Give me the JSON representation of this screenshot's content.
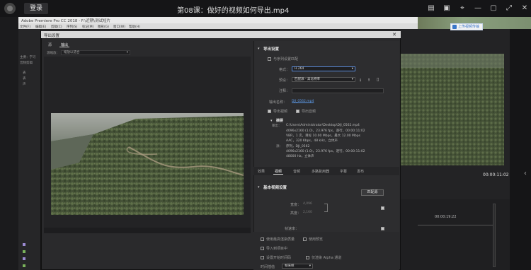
{
  "player": {
    "login_label": "登录",
    "video_title": "第08课：做好的视频如何导出.mp4",
    "tag_text": "上传视频传输"
  },
  "premiere": {
    "title": "Adobe Premiere Pro CC 2018 - F:\\近期\\测试短片",
    "menu": [
      "文件(F)",
      "编辑(E)",
      "剪辑(C)",
      "序列(S)",
      "标记(M)",
      "图形(G)",
      "窗口(W)",
      "帮助(H)"
    ],
    "left_items": [
      "主要：学习",
      "音频剪辑",
      "表",
      "表",
      "声"
    ],
    "right_time": "00:00:11:02",
    "timeline_time": "00:00:19:22"
  },
  "dialog": {
    "title": "导出设置",
    "close": "✕",
    "source_tabs": [
      "源",
      "输出"
    ],
    "source_scaling_label": "源缩放：",
    "source_scaling_value": "缩放以适合",
    "export_settings_header": "导出设置",
    "match_sequence_label": "与序列设置匹配",
    "format_label": "格式：",
    "format_value": "H.264",
    "preset_label": "预设：",
    "preset_value": "匹配源 - 高比特率",
    "comment_label": "注释：",
    "output_name_label": "输出名称：",
    "output_name_value": "DJI_0562.mp4",
    "export_video_label": "导出视频",
    "export_audio_label": "导出音频",
    "summary_header": "摘要",
    "summary_output_label": "输出：",
    "summary_output_lines": [
      "C:\\Users\\Administrator\\Desktop\\DJI_0562.mp4",
      "4096x2160 (1.0)，23.976 fps，逐行，00:00:11:02",
      "VBR，1 次，目标 10.00 Mbps，最大 12.00 Mbps",
      "AAC，320 Kbps，48 kHz，立体声"
    ],
    "summary_source_label": "源：",
    "summary_source_lines": [
      "序列，DJI_0562",
      "4096x2160 (1.0)，23.976 fps，逐行，00:00:11:02",
      "48000 Hz，立体声"
    ],
    "tabs": [
      "效果",
      "视频",
      "音频",
      "多路复用器",
      "字幕",
      "发布"
    ],
    "basic_video_header": "基本视频设置",
    "match_source_button": "匹配源",
    "width_label": "宽度：",
    "width_value": "4,096",
    "height_label": "高度：",
    "height_value": "2,160",
    "framerate_label": "帧速率：",
    "bottom_options": [
      "使用最高渲染质量",
      "使用预览",
      "导入到项目中",
      "设置开始时间码",
      "仅渲染 Alpha 通道"
    ],
    "time_interp_label": "时间插值",
    "time_interp_value": "帧采样"
  }
}
